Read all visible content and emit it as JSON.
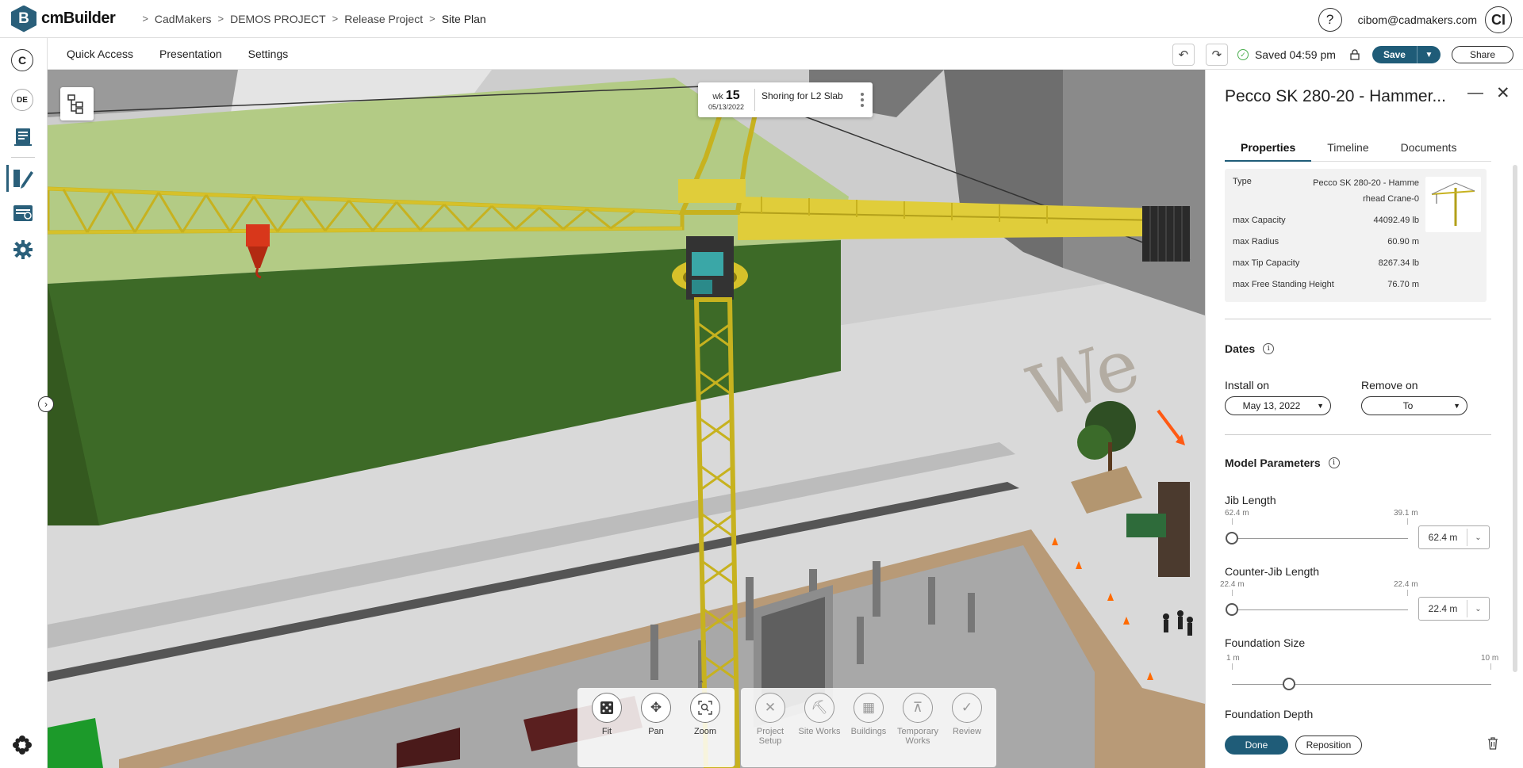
{
  "app": {
    "name": "cmBuilder",
    "logo_letter": "B"
  },
  "breadcrumbs": [
    "CadMakers",
    "DEMOS PROJECT",
    "Release Project",
    "Site Plan"
  ],
  "user": {
    "email": "cibom@cadmakers.com",
    "initials": "CI"
  },
  "help_icon": "?",
  "rail": {
    "c_label": "C",
    "de_label": "DE",
    "icons": [
      "document-icon",
      "design-pencil-icon",
      "schedule-icon",
      "settings-gear-icon",
      "apps-flower-icon"
    ]
  },
  "menu": {
    "items": [
      "Quick Access",
      "Presentation",
      "Settings"
    ]
  },
  "status": {
    "saved_text": "Saved 04:59 pm"
  },
  "actions": {
    "save": "Save",
    "share": "Share"
  },
  "colors": {
    "accent": "#1f5c78",
    "crane": "#d6c12a",
    "building_green": "#3d6a27"
  },
  "week_card": {
    "prefix": "wk",
    "week": "15",
    "date": "05/13/2022",
    "task": "Shoring for L2 Slab"
  },
  "toolbar": {
    "nav": [
      {
        "label": "Fit",
        "icon": "fit-icon"
      },
      {
        "label": "Pan",
        "icon": "pan-icon"
      },
      {
        "label": "Zoom",
        "icon": "zoom-icon"
      }
    ],
    "modes": [
      {
        "label": "Project Setup",
        "icon": "tools-icon"
      },
      {
        "label": "Site Works",
        "icon": "excavator-icon"
      },
      {
        "label": "Buildings",
        "icon": "buildings-icon"
      },
      {
        "label": "Temporary Works",
        "icon": "crane-icon"
      },
      {
        "label": "Review",
        "icon": "review-icon"
      }
    ]
  },
  "panel": {
    "title": "Pecco SK 280-20 - Hammer...",
    "tabs": [
      "Properties",
      "Timeline",
      "Documents"
    ],
    "active_tab": "Properties",
    "properties": [
      {
        "label": "Type",
        "value": "Pecco SK 280-20 - Hamme rhead Crane-0"
      },
      {
        "label": "max Capacity",
        "value": "44092.49 lb"
      },
      {
        "label": "max Radius",
        "value": "60.90 m"
      },
      {
        "label": "max Tip Capacity",
        "value": "8267.34 lb"
      },
      {
        "label": "max Free Standing Height",
        "value": "76.70 m"
      }
    ],
    "dates": {
      "heading": "Dates",
      "install_label": "Install on",
      "install_value": "May 13, 2022",
      "remove_label": "Remove on",
      "remove_value": "To"
    },
    "model_params": {
      "heading": "Model Parameters",
      "jib": {
        "label": "Jib Length",
        "min": "62.4 m",
        "max": "39.1 m",
        "value": "62.4 m",
        "position": 0
      },
      "counter_jib": {
        "label": "Counter-Jib Length",
        "min": "22.4 m",
        "max": "22.4 m",
        "value": "22.4 m",
        "position": 0
      },
      "foundation_size": {
        "label": "Foundation Size",
        "min": "1 m",
        "max": "10 m",
        "position": 0.22
      },
      "foundation_depth": {
        "label": "Foundation Depth"
      }
    },
    "buttons": {
      "done": "Done",
      "reposition": "Reposition"
    }
  }
}
